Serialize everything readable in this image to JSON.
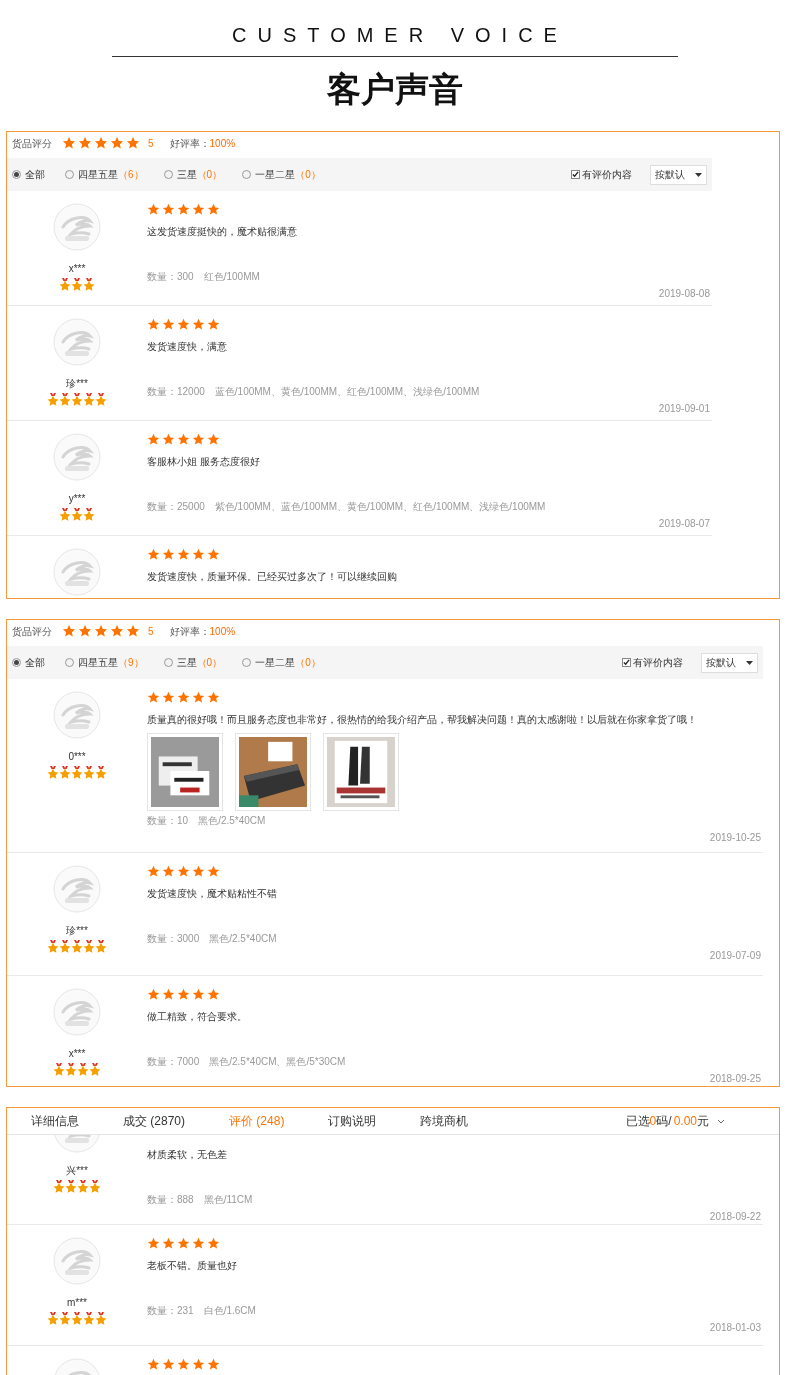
{
  "heading": {
    "english": "CUSTOMER VOICE",
    "chinese": "客户声音"
  },
  "panels": [
    {
      "summary": {
        "label": "货品评分",
        "stars": 5,
        "score": "5",
        "rate_label": "好评率：",
        "rate": "100%"
      },
      "filters": [
        {
          "label": "全部",
          "selected": true
        },
        {
          "label": "四星五星",
          "count": "（6）",
          "selected": false
        },
        {
          "label": "三星",
          "count": "（0）",
          "selected": false
        },
        {
          "label": "一星二星",
          "count": "（0）",
          "selected": false
        }
      ],
      "content_filter": {
        "label": "有评价内容",
        "checked": true
      },
      "sort": {
        "value": "按默认"
      },
      "reviews": [
        {
          "user": "x***",
          "buyer_level": {
            "stars": 3
          },
          "stars": 5,
          "comment": "这发货速度挺快的，魔术贴很满意",
          "quantity": "数量：300",
          "specs": "红色/100MM",
          "date": "2019-08-08"
        },
        {
          "user": "珍***",
          "buyer_level": {
            "stars": 5
          },
          "stars": 5,
          "comment": "发货速度快，满意",
          "quantity": "数量：12000",
          "specs": "蓝色/100MM、黄色/100MM、红色/100MM、浅绿色/100MM",
          "date": "2019-09-01"
        },
        {
          "user": "y***",
          "buyer_level": {
            "stars": 3
          },
          "stars": 5,
          "comment": "客服林小姐 服务态度很好",
          "quantity": "数量：25000",
          "specs": "紫色/100MM、蓝色/100MM、黄色/100MM、红色/100MM、浅绿色/100MM",
          "date": "2019-08-07"
        },
        {
          "stars": 5,
          "comment": "发货速度快，质量环保。已经买过多次了！可以继续回购"
        }
      ]
    },
    {
      "summary": {
        "label": "货品评分",
        "stars": 5,
        "score": "5",
        "rate_label": "好评率：",
        "rate": "100%"
      },
      "filters": [
        {
          "label": "全部",
          "selected": true
        },
        {
          "label": "四星五星",
          "count": "（9）",
          "selected": false
        },
        {
          "label": "三星",
          "count": "（0）",
          "selected": false
        },
        {
          "label": "一星二星",
          "count": "（0）",
          "selected": false
        }
      ],
      "content_filter": {
        "label": "有评价内容",
        "checked": true
      },
      "sort": {
        "value": "按默认"
      },
      "reviews": [
        {
          "user": "0***",
          "buyer_level": {
            "stars": 5
          },
          "stars": 5,
          "comment": "质量真的很好哦！而且服务态度也非常好，很热情的给我介绍产品，帮我解决问题！真的太感谢啦！以后就在你家拿货了哦！",
          "photos": [
            {
              "kind": "picture"
            },
            {
              "kind": "picture"
            },
            {
              "kind": "picture"
            }
          ],
          "quantity": "数量：10",
          "specs": "黑色/2.5*40CM",
          "date": "2019-10-25"
        },
        {
          "user": "珍***",
          "buyer_level": {
            "stars": 5
          },
          "stars": 5,
          "comment": "发货速度快，魔术贴粘性不错",
          "quantity": "数量：3000",
          "specs": "黑色/2.5*40CM",
          "date": "2019-07-09"
        },
        {
          "user": "x***",
          "buyer_level": {
            "stars": 4
          },
          "stars": 5,
          "comment": "做工精致，符合要求。",
          "quantity": "数量：7000",
          "specs": "黑色/2.5*40CM、黑色/5*30CM",
          "date": "2018-09-25"
        }
      ]
    },
    {
      "tabs": [
        {
          "label": "详细信息",
          "selected": false
        },
        {
          "label": "成交 (2870)",
          "selected": false
        },
        {
          "label": "评价 (248)",
          "selected": true
        },
        {
          "label": "订购说明",
          "selected": false
        },
        {
          "label": "跨境商机",
          "selected": false
        }
      ],
      "selection": {
        "prefix": "已选",
        "count": "0",
        "unit": "码",
        "separator": "/",
        "amount": "0.00",
        "currency": "元"
      },
      "reviews": [
        {
          "user": "兴***",
          "buyer_level": {
            "stars": 4
          },
          "comment": "材质柔软，无色差",
          "quantity": "数量：888",
          "specs": "黑色/11CM",
          "date": "2018-09-22"
        },
        {
          "user": "m***",
          "buyer_level": {
            "stars": 5
          },
          "stars": 5,
          "comment": "老板不错。质量也好",
          "quantity": "数量：231",
          "specs": "白色/1.6CM",
          "date": "2018-01-03"
        },
        {
          "stars": 5
        }
      ]
    }
  ]
}
